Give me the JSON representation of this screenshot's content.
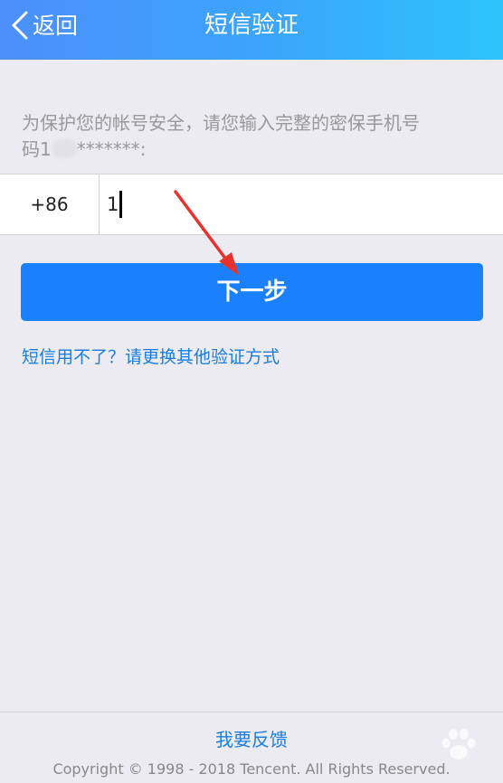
{
  "header": {
    "back_label": "返回",
    "title": "短信验证"
  },
  "prompt": {
    "line1": "为保护您的帐号安全，请您输入完整的密保手机号",
    "line2_start": "码1",
    "line2_end": "*******:"
  },
  "phone_input": {
    "country_code": "+86",
    "value": "1"
  },
  "next_button": {
    "label": "下一步"
  },
  "alt_verification_link": "短信用不了？请更换其他验证方式",
  "footer": {
    "feedback_link": "我要反馈",
    "copyright": "Copyright © 1998 - 2018 Tencent. All Rights Reserved."
  },
  "colors": {
    "header_start": "#4c8ffb",
    "header_end": "#2cc4fb",
    "button": "#1b80fb",
    "link": "#1a7de0",
    "annotation_arrow": "#e8322e"
  },
  "icons": {
    "back": "chevron-left-icon",
    "watermark": "baidu-paw-icon"
  }
}
